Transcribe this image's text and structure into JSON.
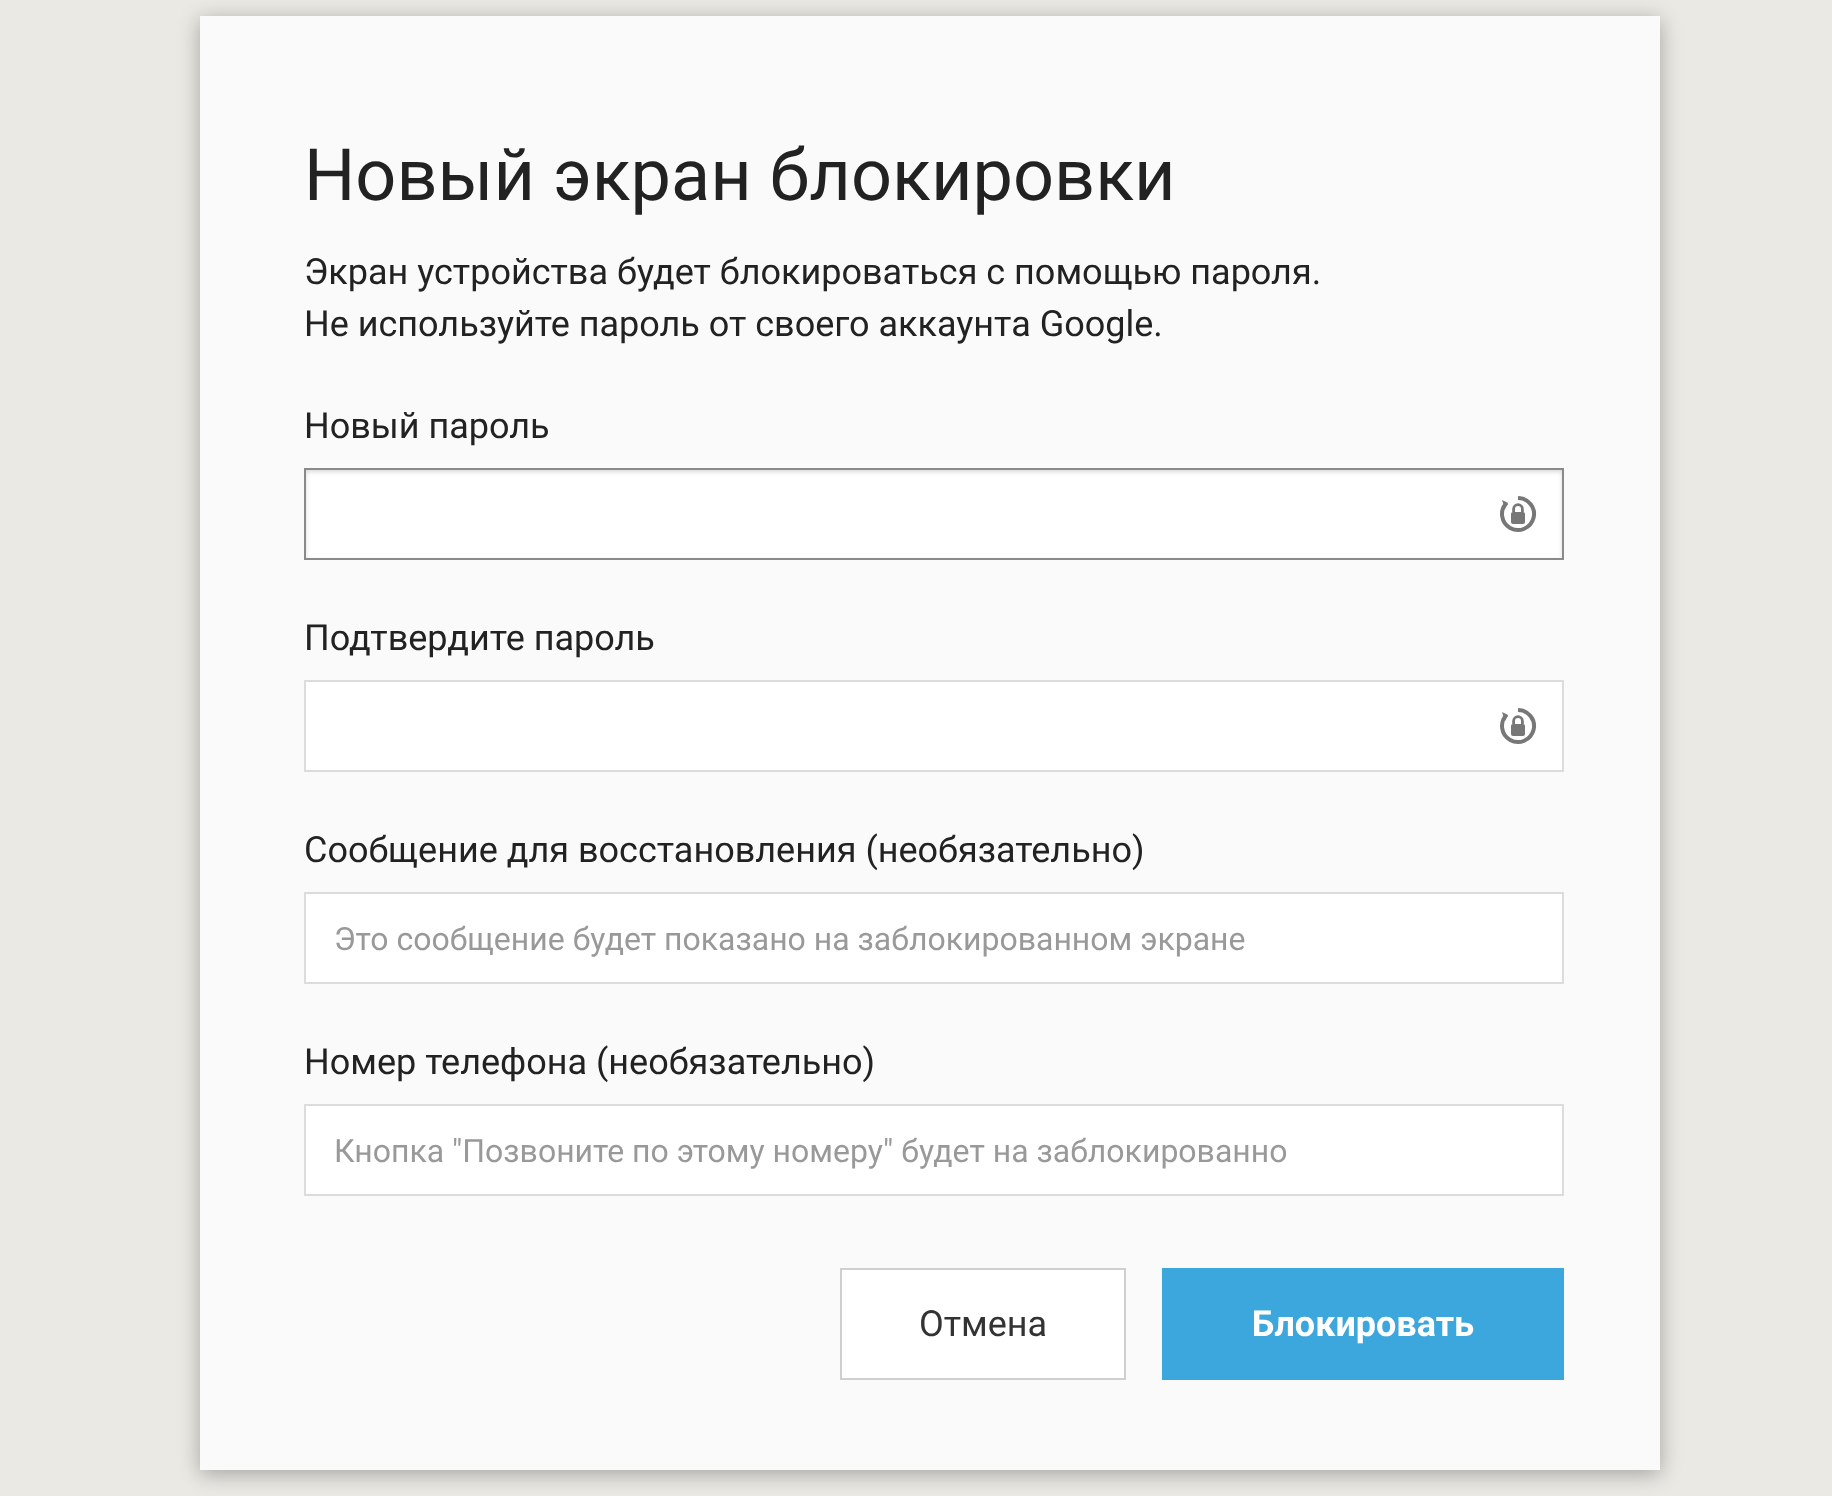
{
  "dialog": {
    "title": "Новый экран блокировки",
    "description": [
      "Экран устройства будет блокироваться с помощью пароля.",
      "Не используйте пароль от своего аккаунта Google."
    ],
    "fields": [
      {
        "kind": "password",
        "label": "Новый пароль",
        "focused": true
      },
      {
        "kind": "password",
        "label": "Подтвердите пароль",
        "focused": false
      },
      {
        "kind": "text",
        "label": "Сообщение для восстановления (необязательно)",
        "placeholder": "Это сообщение будет показано на заблокированном экране",
        "focused": false
      },
      {
        "kind": "text",
        "label": "Номер телефона (необязательно)",
        "placeholder": "Кнопка \"Позвоните по этому номеру\" будет на заблокированно",
        "focused": false
      }
    ],
    "buttons": [
      {
        "kind": "secondary",
        "label": "Отмена"
      },
      {
        "kind": "primary",
        "label": "Блокировать"
      }
    ]
  }
}
